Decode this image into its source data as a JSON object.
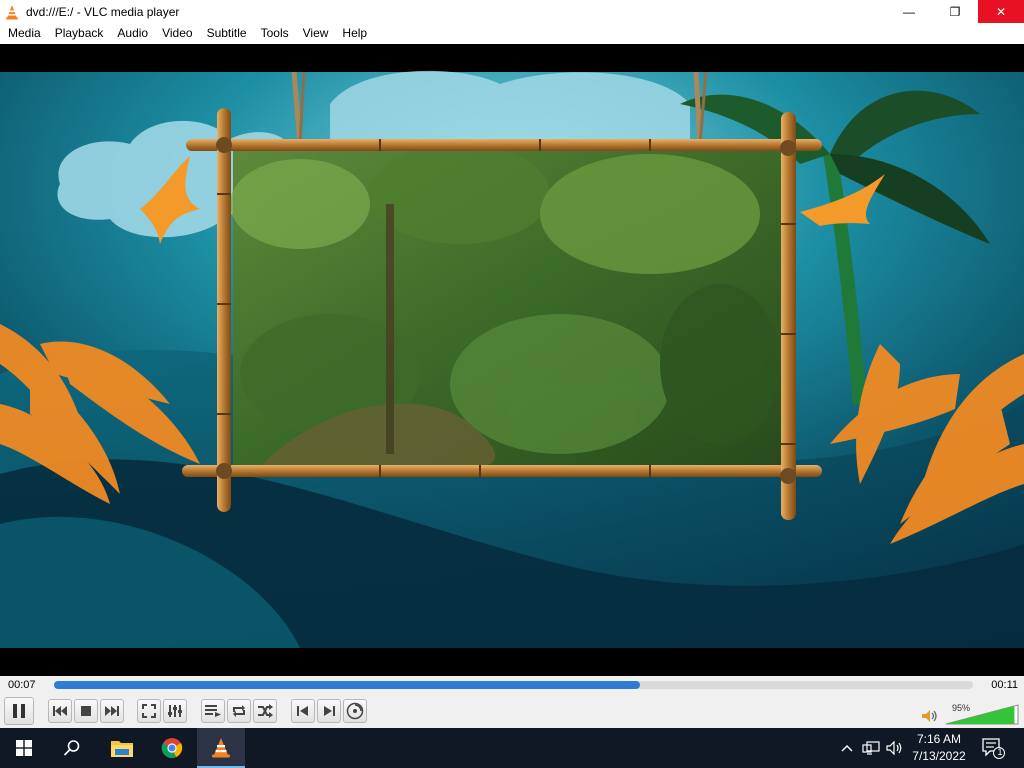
{
  "window": {
    "title": "dvd:///E:/ - VLC media player",
    "minimize_glyph": "—",
    "maximize_glyph": "❐",
    "close_glyph": "✕"
  },
  "menu": [
    "Media",
    "Playback",
    "Audio",
    "Video",
    "Subtitle",
    "Tools",
    "View",
    "Help"
  ],
  "player": {
    "elapsed": "00:07",
    "total": "00:11",
    "progress_fraction": 0.638,
    "volume_label": "95%",
    "volume_fraction": 0.95
  },
  "controls": {
    "icons": [
      "pause-icon",
      "previous-icon",
      "stop-icon",
      "next-icon",
      "fullscreen-icon",
      "extended-settings-icon",
      "playlist-icon",
      "loop-icon",
      "shuffle-icon",
      "frame-back-icon",
      "frame-next-icon",
      "dvd-menu-icon"
    ]
  },
  "taskbar": {
    "apps": [
      "windows-start-icon",
      "search-icon",
      "file-explorer-icon",
      "chrome-icon",
      "vlc-icon"
    ],
    "time": "7:16 AM",
    "date": "7/13/2022",
    "notification_count": "1"
  },
  "colors": {
    "accent": "#2f7cd3",
    "close_red": "#e81123",
    "vlc_orange": "#f58220",
    "taskbar": "#101826",
    "volume_green": "#35c33a"
  }
}
